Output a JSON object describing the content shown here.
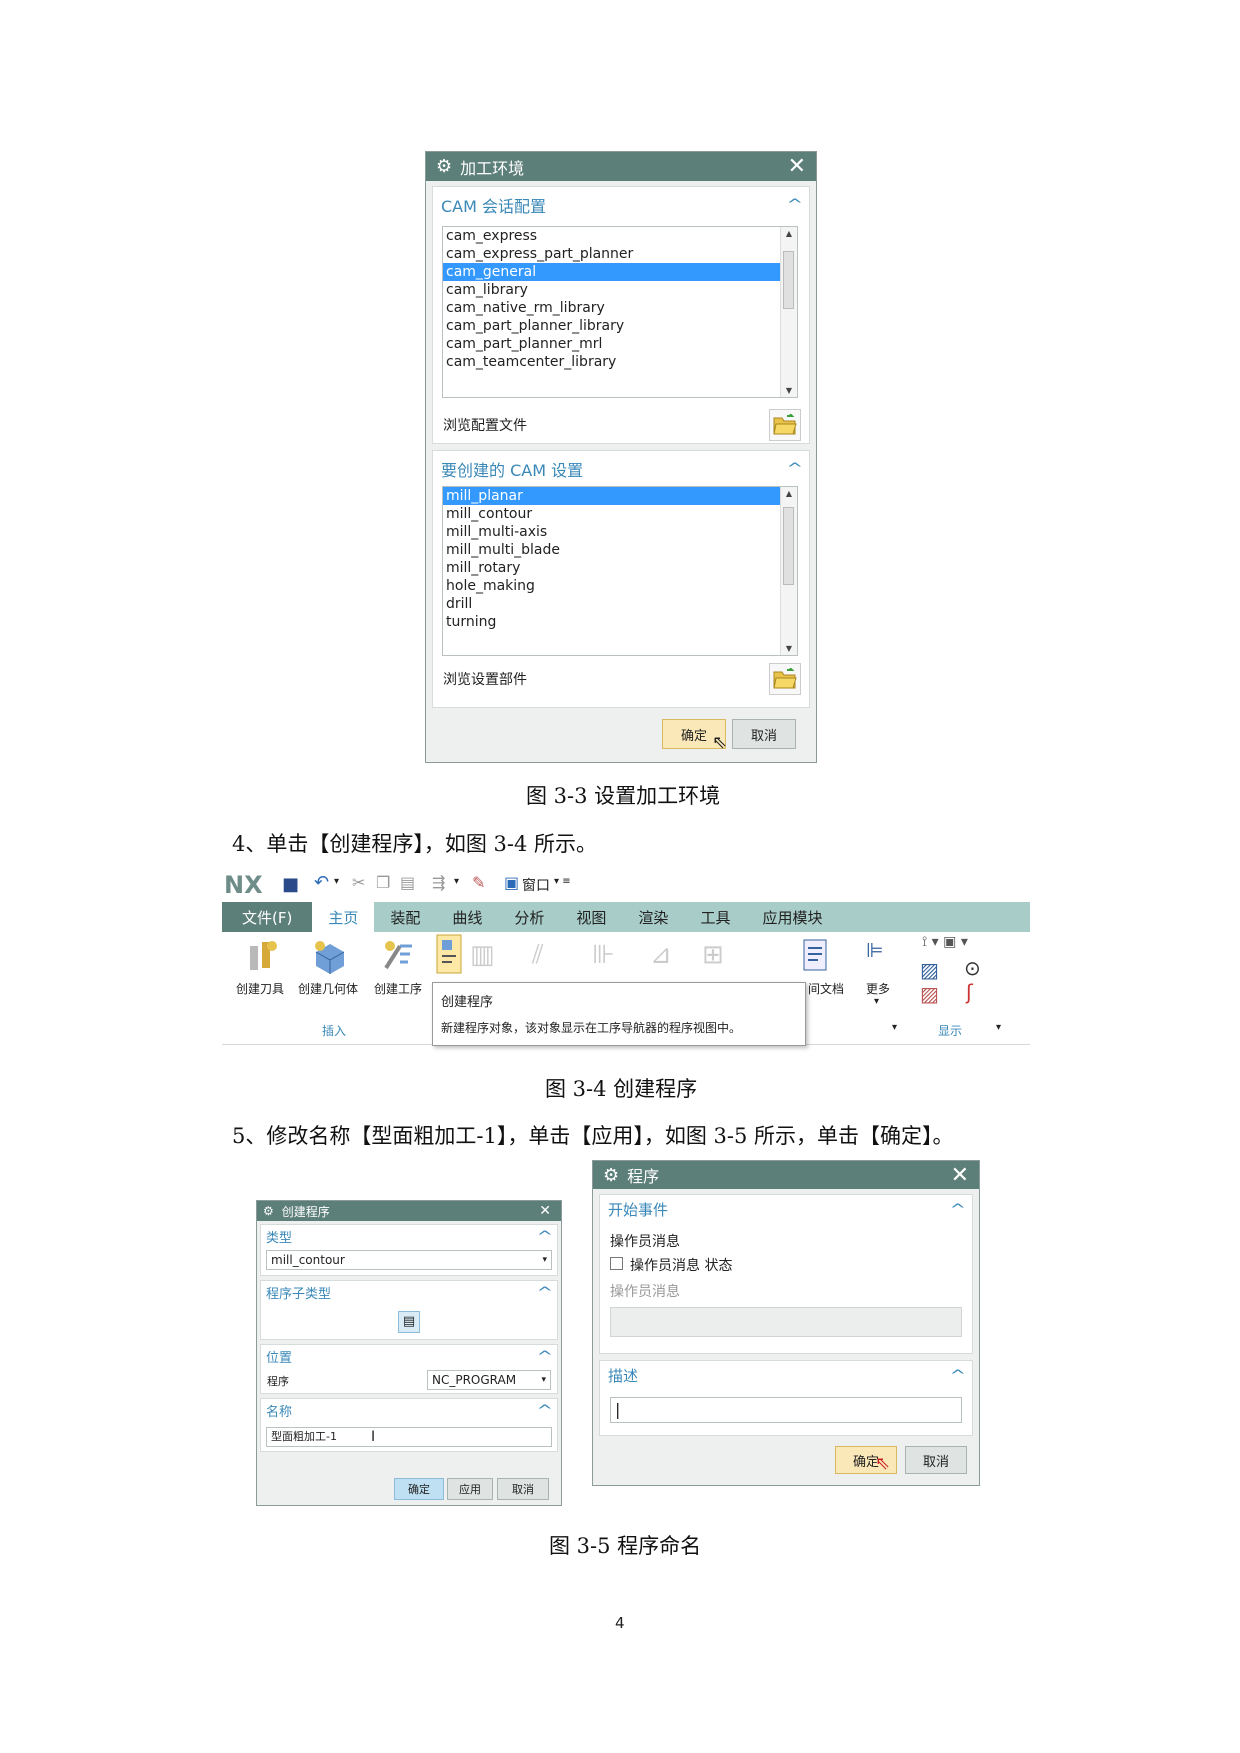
{
  "fig3": {
    "dialog_title": "加工环境",
    "section1_title": "CAM 会话配置",
    "config_items": [
      "cam_express",
      "cam_express_part_planner",
      "cam_general",
      "cam_library",
      "cam_native_rm_library",
      "cam_part_planner_library",
      "cam_part_planner_mrl",
      "cam_teamcenter_library"
    ],
    "config_selected_index": 2,
    "browse_config_label": "浏览配置文件",
    "section2_title": "要创建的 CAM 设置",
    "setup_items": [
      "mill_planar",
      "mill_contour",
      "mill_multi-axis",
      "mill_multi_blade",
      "mill_rotary",
      "hole_making",
      "drill",
      "turning"
    ],
    "setup_selected_index": 0,
    "browse_setup_label": "浏览设置部件",
    "ok": "确定",
    "cancel": "取消",
    "caption": "图 3-3 设置加工环境"
  },
  "step4": "4、单击【创建程序】，如图 3-4 所示。",
  "fig4": {
    "logo": "NX",
    "window_menu": "窗口",
    "tabs": [
      "文件(F)",
      "主页",
      "装配",
      "曲线",
      "分析",
      "视图",
      "渲染",
      "工具",
      "应用模块"
    ],
    "active_tab_index": 1,
    "buttons": [
      "创建刀具",
      "创建几何体",
      "创建工序"
    ],
    "group_insert": "插入",
    "partial_label": "间文档",
    "more": "更多",
    "group_display": "显示",
    "tooltip_title": "创建程序",
    "tooltip_text": "新建程序对象，该对象显示在工序导航器的程序视图中。",
    "caption": "图 3-4  创建程序"
  },
  "step5": "5、修改名称【型面粗加工-1】，单击【应用】，如图 3-5 所示，单击【确定】。",
  "fig5a": {
    "dialog_title": "创建程序",
    "type_label": "类型",
    "type_value": "mill_contour",
    "subtype_label": "程序子类型",
    "location_label": "位置",
    "program_label": "程序",
    "program_value": "NC_PROGRAM",
    "name_label": "名称",
    "name_value": "型面粗加工-1",
    "ok": "确定",
    "apply": "应用",
    "cancel": "取消"
  },
  "fig5b": {
    "dialog_title": "程序",
    "start_event_label": "开始事件",
    "operator_msg_label": "操作员消息",
    "checkbox_label": "操作员消息 状态",
    "operator_msg_field_label": "操作员消息",
    "description_label": "描述",
    "ok": "确定",
    "cancel": "取消"
  },
  "fig5_caption": "图 3-5 程序命名",
  "page_number": "4"
}
